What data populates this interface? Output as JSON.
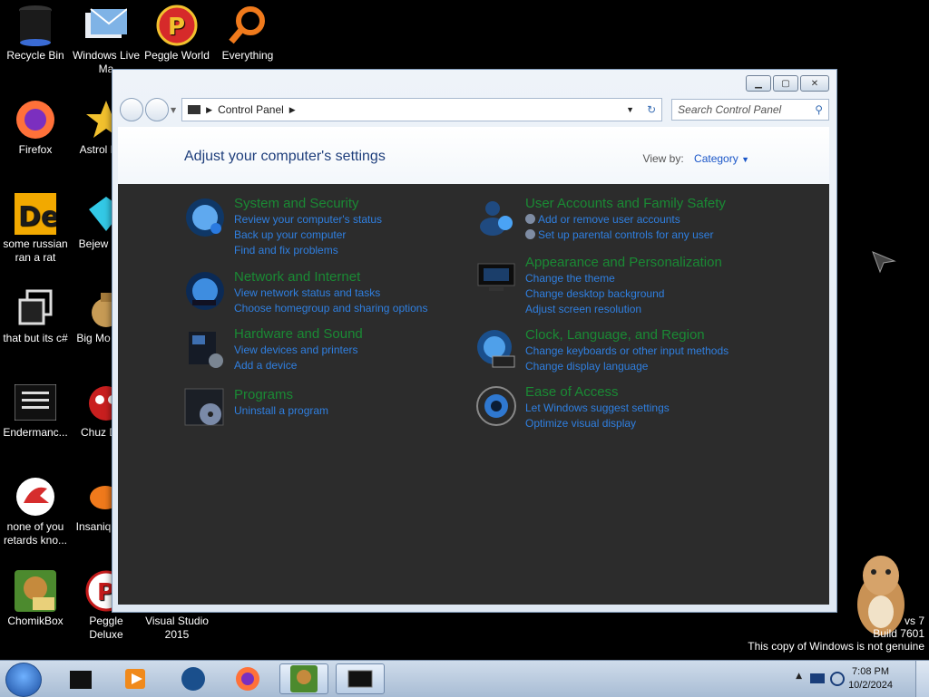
{
  "desktop": {
    "icons": [
      {
        "label": "Recycle Bin"
      },
      {
        "label": "Windows Live Ma"
      },
      {
        "label": "Peggle World"
      },
      {
        "label": "Everything"
      },
      {
        "label": "Firefox"
      },
      {
        "label": "Astrol Delu"
      },
      {
        "label": "some russian ran a rat"
      },
      {
        "label": "Bejew Delu"
      },
      {
        "label": "that but its c#"
      },
      {
        "label": "Big Mo Delu"
      },
      {
        "label": "Endermanc..."
      },
      {
        "label": "Chuz Delu"
      },
      {
        "label": "none of you retards kno..."
      },
      {
        "label": "Insaniq Delu"
      },
      {
        "label": "ChomikBox"
      },
      {
        "label": "Peggle Deluxe"
      },
      {
        "label": "Visual Studio 2015"
      }
    ],
    "watermark": {
      "line1": "vs 7",
      "line2": "Build 7601",
      "line3": "This copy of Windows is not genuine"
    }
  },
  "window": {
    "address": {
      "path": "Control Panel"
    },
    "search": {
      "placeholder": "Search Control Panel"
    },
    "header": {
      "title": "Adjust your computer's settings",
      "view_by_label": "View by:",
      "view_by_value": "Category"
    },
    "categories": [
      {
        "title": "System and Security",
        "links": [
          "Review your computer's status",
          "Back up your computer",
          "Find and fix problems"
        ]
      },
      {
        "title": "Network and Internet",
        "links": [
          "View network status and tasks",
          "Choose homegroup and sharing options"
        ]
      },
      {
        "title": "Hardware and Sound",
        "links": [
          "View devices and printers",
          "Add a device"
        ]
      },
      {
        "title": "Programs",
        "links": [
          "Uninstall a program"
        ]
      },
      {
        "title": "User Accounts and Family Safety",
        "links": [
          "Add or remove user accounts",
          "Set up parental controls for any user"
        ]
      },
      {
        "title": "Appearance and Personalization",
        "links": [
          "Change the theme",
          "Change desktop background",
          "Adjust screen resolution"
        ]
      },
      {
        "title": "Clock, Language, and Region",
        "links": [
          "Change keyboards or other input methods",
          "Change display language"
        ]
      },
      {
        "title": "Ease of Access",
        "links": [
          "Let Windows suggest settings",
          "Optimize visual display"
        ]
      }
    ]
  },
  "taskbar": {
    "time": "7:08 PM",
    "date": "10/2/2024",
    "items": [
      "start-button",
      "taskbar-item-1",
      "taskbar-item-2",
      "taskbar-item-3",
      "taskbar-item-4",
      "taskbar-item-5",
      "taskbar-item-6"
    ]
  },
  "colors": {
    "link": "#2f7fe0",
    "category_title": "#1a8a34",
    "header_text": "#1e3e7b"
  }
}
